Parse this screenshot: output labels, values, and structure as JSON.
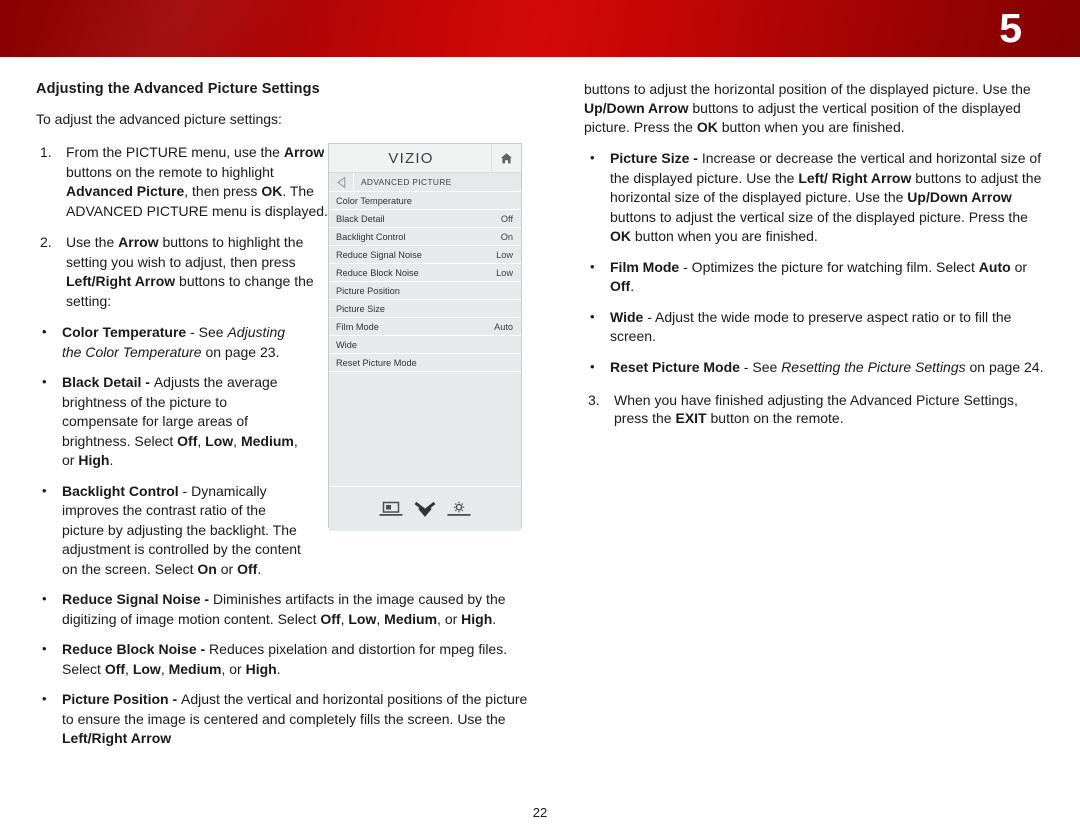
{
  "header": {
    "chapter_number": "5",
    "band_color_left": "#8a0202",
    "band_color_center": "#d40808",
    "band_color_right": "#820101"
  },
  "left_column": {
    "section_title": "Adjusting the Advanced Picture Settings",
    "lead": "To adjust the advanced picture settings:",
    "steps": [
      {
        "num": "1.",
        "html": "From the PICTURE menu, use the <b>Arrow</b> buttons on the remote to highlight <b>Advanced Picture</b>, then press <b>OK</b>. The ADVANCED PICTURE menu is displayed."
      },
      {
        "num": "2.",
        "html": "Use the <b>Arrow</b> buttons to highlight the setting you wish to adjust, then press <b>Left/Right Arrow</b> buttons to change the setting:"
      }
    ],
    "bullets": [
      "<b>Color Temperature</b> - See <i>Adjusting the Color Temperature</i> on page 23.",
      "<b>Black Detail - </b>Adjusts the average brightness of the picture to compensate for large areas of brightness. Select <b>Off</b>, <b>Low</b>, <b>Medium</b>, or <b>High</b>.",
      "<b>Backlight Control</b> - Dynamically improves the contrast ratio of the picture by adjusting the backlight. The adjustment is controlled by the content on the screen. Select <b>On</b> or <b>Off</b>."
    ],
    "bullets_wide": [
      "<b>Reduce Signal Noise - </b>Diminishes artifacts in the image caused by the digitizing of image motion content. Select <b>Off</b>, <b>Low</b>, <b>Medium</b>, or <b>High</b>.",
      "<b>Reduce Block Noise - </b>Reduces pixelation and distortion for mpeg files. Select <b>Off</b>, <b>Low</b>, <b>Medium</b>, or <b>High</b>.",
      "<b>Picture Position - </b>Adjust the vertical and horizontal positions of the picture to ensure the image is centered and completely fills the screen. Use the <b>Left/Right Arrow</b>"
    ]
  },
  "right_column": {
    "continuation": "buttons to adjust the horizontal position of the displayed picture. Use the <b>Up/Down Arrow</b> buttons to adjust the vertical position of the displayed picture. Press the <b>OK</b> button when you are finished.",
    "bullets": [
      "<b>Picture Size - </b>Increase or decrease the vertical and horizontal size of the displayed picture. Use the <b>Left/ Right Arrow</b> buttons to adjust the horizontal size of the displayed picture. Use the <b>Up/Down Arrow</b> buttons to adjust the vertical size of the displayed picture. Press the <b>OK</b> button when you are finished.",
      "<b>Film Mode</b> - Optimizes the picture for watching film. Select <b>Auto</b> or <b>Off</b>.",
      "<b>Wide</b> - Adjust the wide mode to preserve aspect ratio or to fill the screen.",
      "<b>Reset Picture Mode</b> - See <i>Resetting the Picture Settings</i> on page 24."
    ],
    "steps": [
      {
        "num": "3.",
        "html": "When you have finished adjusting the Advanced Picture Settings, press the <b>EXIT</b> button on the remote."
      }
    ]
  },
  "tv_menu": {
    "brand": "VIZIO",
    "home_icon": "home-icon",
    "back_icon": "back-arrow-icon",
    "breadcrumb": "ADVANCED PICTURE",
    "rows": [
      {
        "label": "Color Temperature",
        "value": ""
      },
      {
        "label": "Black Detail",
        "value": "Off"
      },
      {
        "label": "Backlight Control",
        "value": "On"
      },
      {
        "label": "Reduce Signal Noise",
        "value": "Low"
      },
      {
        "label": "Reduce Block Noise",
        "value": "Low"
      },
      {
        "label": "Picture Position",
        "value": ""
      },
      {
        "label": "Picture Size",
        "value": ""
      },
      {
        "label": "Film Mode",
        "value": "Auto"
      },
      {
        "label": "Wide",
        "value": ""
      },
      {
        "label": "Reset Picture Mode",
        "value": ""
      }
    ],
    "footer_icons": [
      "picture-screen-icon",
      "double-chevron-down-icon",
      "brightness-gear-icon"
    ]
  },
  "footer": {
    "page_number": "22"
  }
}
